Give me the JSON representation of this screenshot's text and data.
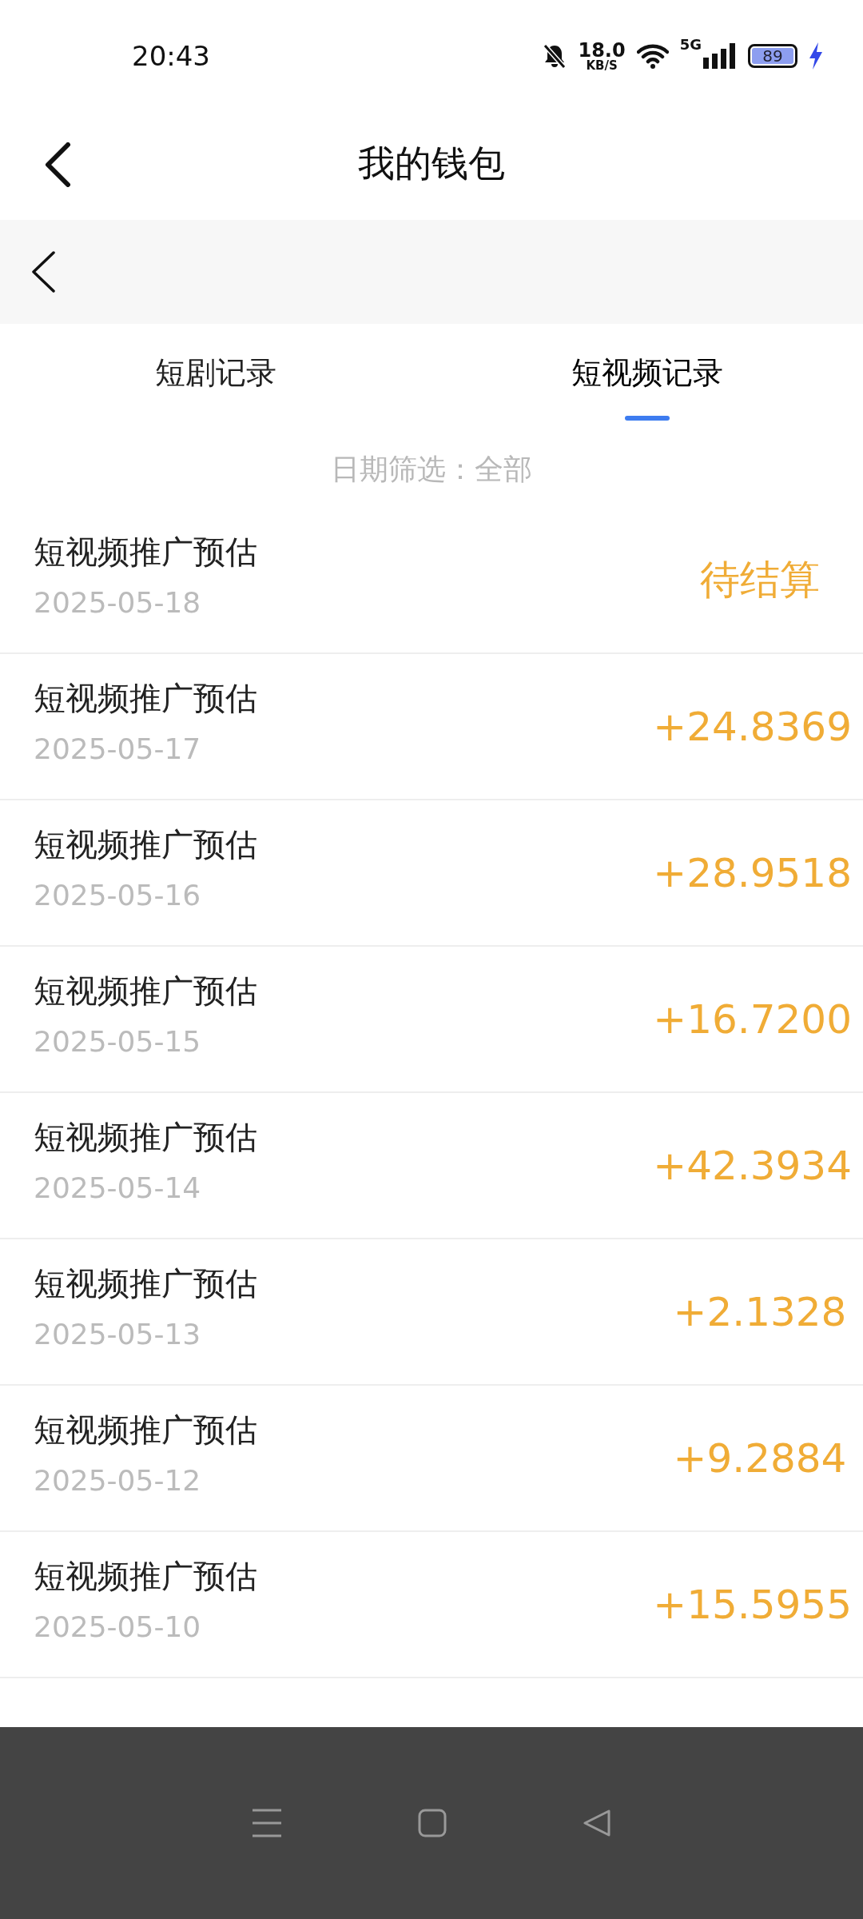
{
  "status_bar": {
    "time": "20:43",
    "net_speed": "18.0",
    "net_unit": "KB/S",
    "network": "5G",
    "battery": "89",
    "charging": true
  },
  "header": {
    "title": "我的钱包"
  },
  "tabs": [
    {
      "label": "短剧记录",
      "selected": false
    },
    {
      "label": "短视频记录",
      "selected": true
    }
  ],
  "filter": "日期筛选：全部",
  "records": [
    {
      "title": "短视频推广预估",
      "date": "2025-05-18",
      "amount": "待结算"
    },
    {
      "title": "短视频推广预估",
      "date": "2025-05-17",
      "amount": "+24.8369"
    },
    {
      "title": "短视频推广预估",
      "date": "2025-05-16",
      "amount": "+28.9518"
    },
    {
      "title": "短视频推广预估",
      "date": "2025-05-15",
      "amount": "+16.7200"
    },
    {
      "title": "短视频推广预估",
      "date": "2025-05-14",
      "amount": "+42.3934"
    },
    {
      "title": "短视频推广预估",
      "date": "2025-05-13",
      "amount": "+2.1328"
    },
    {
      "title": "短视频推广预估",
      "date": "2025-05-12",
      "amount": "+9.2884"
    },
    {
      "title": "短视频推广预估",
      "date": "2025-05-10",
      "amount": "+15.5955"
    }
  ]
}
